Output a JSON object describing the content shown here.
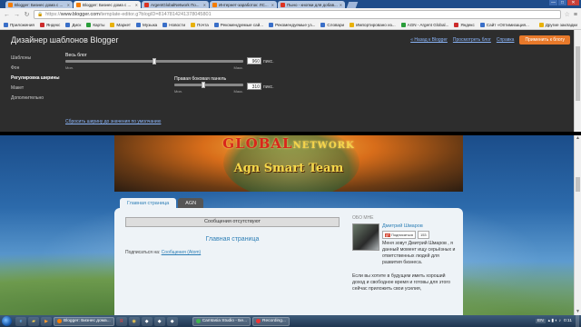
{
  "browser": {
    "tabs": [
      {
        "title": "Blogger: Бизнес дома с ...",
        "active": false
      },
      {
        "title": "Blogger: Бизнес дома с ...",
        "active": true
      },
      {
        "title": "ArgentGlobalNetwork По...",
        "active": false
      },
      {
        "title": "Интернет-заработок: ЛС...",
        "active": false
      },
      {
        "title": "Пыно - кнопки для добав...",
        "active": false
      }
    ],
    "window_controls": {
      "minimize": "—",
      "maximize": "□",
      "close": "✕"
    },
    "url_scheme": "https://",
    "url_host": "www.blogger.com",
    "url_path": "/template-editor.g?blogID=8147814241378045801",
    "bookmarks": [
      "Приложения",
      "Яндекс",
      "Диск",
      "Карты",
      "Маркет",
      "Музыка",
      "Новости",
      "Почта",
      "Рекомендуемые сай...",
      "Рекомендуемые уз...",
      "Словари",
      "Импортировано из...",
      "AGN - Argent Global...",
      "Яндекс",
      "Сайт «Оптимизация..."
    ],
    "other_bookmarks": "Другие закладки"
  },
  "designer": {
    "title": "Дизайнер шаблонов Blogger",
    "links": {
      "back": "« Назад к Blogger",
      "view_blog": "Просмотреть блог",
      "help": "Справка"
    },
    "apply_button": "Применить к блогу",
    "menu": [
      "Шаблоны",
      "Фон",
      "Регулировка ширины",
      "Макет",
      "Дополнительно"
    ],
    "active_menu_index": 2,
    "whole_blog": {
      "label": "Весь блог",
      "value": "960",
      "unit": "пикс.",
      "min": "Мин.",
      "max": "Макс.",
      "fraction": 0.5
    },
    "right_sidebar": {
      "label": "Правая боковая панель",
      "value": "310",
      "unit": "пикс.",
      "min": "Мин.",
      "max": "Макс.",
      "fraction": 0.42
    },
    "reset_link": "Сбросить ширину до значения по умолчанию"
  },
  "blog": {
    "banner_title_big": "GLOBAL",
    "banner_title_small": "NETWORK",
    "banner_sub": "Agn Smart Team",
    "tabs": [
      "Главная страница",
      "AGN"
    ],
    "no_messages": "Сообщения отсутствуют",
    "home_link": "Главная страница",
    "subscribe_prefix": "Подписаться на:",
    "subscribe_link": "Сообщения (Atom)",
    "about_title": "ОБО МНЕ",
    "profile_name": "Дмитрий Шмаров",
    "follow_label": "Подписаться",
    "follow_gplus": "g+",
    "follower_count": "153",
    "about_p1": "Меня зовут Дмитрий Шмаров , я данный момент ищу серьёзных и ответственных людей для развития бизнеса.",
    "about_p2": "Если вы хотите в будущем иметь хороший доход и свободное время и готовы для этого сейчас приложить свои усилия,"
  },
  "taskbar": {
    "tasks": [
      "Blogger: Бизнес дома...",
      "Camtasia Studio - Бе...",
      "Recording..."
    ],
    "language": "EN",
    "clock": "0:11"
  },
  "colors": {
    "accent_orange": "#e8792a",
    "link_blue": "#8ab4f8",
    "blog_link": "#2e7fb6",
    "designer_bg": "#2d2d2d"
  }
}
